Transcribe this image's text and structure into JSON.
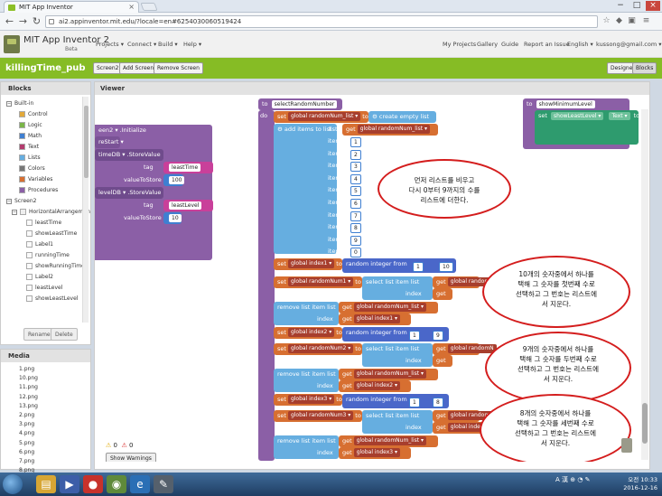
{
  "browser": {
    "tab_title": "MIT App Inventor",
    "tab_close": "×",
    "url": "ai2.appinventor.mit.edu/?locale=en#6254030060519424",
    "window_min": "−",
    "window_max": "□",
    "window_close": "×"
  },
  "app": {
    "title": "MIT App Inventor 2",
    "beta": "Beta",
    "menus": [
      "Projects ▾",
      "Connect ▾",
      "Build ▾",
      "Help ▾"
    ],
    "right_menus": [
      "My Projects",
      "Gallery",
      "Guide",
      "Report an Issue",
      "English ▾",
      "kussong@gmail.com ▾"
    ]
  },
  "project": {
    "name": "killingTime_pub",
    "screen_btn": "Screen2 ▾",
    "add_screen": "Add Screen ...",
    "remove_screen": "Remove Screen",
    "designer": "Designer",
    "blocks": "Blocks"
  },
  "blocks_panel": {
    "title": "Blocks",
    "builtin": "Built-in",
    "builtin_items": [
      {
        "label": "Control",
        "color": "#e2a93a"
      },
      {
        "label": "Logic",
        "color": "#7ab548"
      },
      {
        "label": "Math",
        "color": "#3f7fd1"
      },
      {
        "label": "Text",
        "color": "#b33b6e"
      },
      {
        "label": "Lists",
        "color": "#66aee0"
      },
      {
        "label": "Colors",
        "color": "#777777"
      },
      {
        "label": "Variables",
        "color": "#d76f31"
      },
      {
        "label": "Procedures",
        "color": "#8b5fa6"
      }
    ],
    "screen": "Screen2",
    "arrangement": "HorizontalArrangemen",
    "components": [
      "leastTime",
      "showLeastTime",
      "Label1",
      "runningTime",
      "showRunningTime",
      "Label2",
      "leastLevel",
      "showLeastLevel"
    ],
    "rename": "Rename",
    "delete": "Delete"
  },
  "media": {
    "title": "Media",
    "files": [
      "1.png",
      "10.png",
      "11.png",
      "12.png",
      "13.png",
      "2.png",
      "3.png",
      "4.png",
      "5.png",
      "6.png",
      "7.png",
      "8.png"
    ]
  },
  "viewer": {
    "title": "Viewer",
    "warnings_count": "0",
    "errors_count": "0",
    "show_warnings": "Show Warnings"
  },
  "blocks": {
    "proc_to": "to",
    "proc_name": "selectRandomNumber",
    "do": "do",
    "set": "set",
    "to": "to",
    "var_list": "global randomNum_list ▾",
    "create_empty": "create empty list",
    "add_items": "add items to list",
    "list_label": "list",
    "get": "get",
    "item": "item",
    "items": [
      "1",
      "2",
      "3",
      "4",
      "5",
      "6",
      "7",
      "8",
      "9",
      "0"
    ],
    "random_integer": "random integer from",
    "var_index1": "global index1 ▾",
    "var_index2": "global index2 ▾",
    "var_index3": "global index3 ▾",
    "var_num1": "global randomNum1 ▾",
    "var_num2": "global randomNum2 ▾",
    "var_num3": "global randomNum3 ▾",
    "get_index1": "global index1 ▾",
    "get_index2": "global index2 ▾",
    "get_index3": "global index3 ▾",
    "select_item": "select list item list",
    "index": "index",
    "get_partial": "get",
    "get_randomnum_partial": "global randomN",
    "get_index_partial": "global index3",
    "remove_item": "remove list item list",
    "from1": "1",
    "to1": "10",
    "from2": "1",
    "to2": "9",
    "from3": "1",
    "to3": "8",
    "left_init": "een2 ▾ .Initialize",
    "left_restart": "reStart ▾",
    "left_timedb": "timeDB ▾ .StoreValue",
    "left_tag": "tag",
    "left_tag1_val": "leastTime",
    "left_value": "valueToStore",
    "left_val1": "100",
    "left_leveldb": "levelDB ▾ .StoreValue",
    "left_tag2_val": "leastLevel",
    "left_val2": "10",
    "top_right_to": "to",
    "top_right_name": "showMinimumLevel",
    "top_right_set": "set",
    "top_right_comp": "showLeastLevel ▾",
    "top_right_prop": "Text ▾",
    "top_right_to2": "to"
  },
  "notes": [
    "먼저 리스트를 비우고\n다시 0부터 9까지의 수를\n리스트에 더한다.",
    "10개의 숫자중에서 하나를\n택해 그 숫자를 첫번째 수로\n선택하고 그 번호는 리스트에\n서 지운다.",
    "9개의 숫자중에서 하나를\n택해 그 숫자를 두번째 수로\n선택하고 그 번호는 리스트에\n서 지운다.",
    "8개의 숫자중에서 하나를\n택해 그 숫자를 세번째 수로\n선택하고 그 번호는 리스트에\n서 지운다."
  ],
  "taskbar": {
    "tray": "A 漢 ⊕ ◔ ✎",
    "time": "오전 10:33",
    "date": "2016-12-16"
  }
}
